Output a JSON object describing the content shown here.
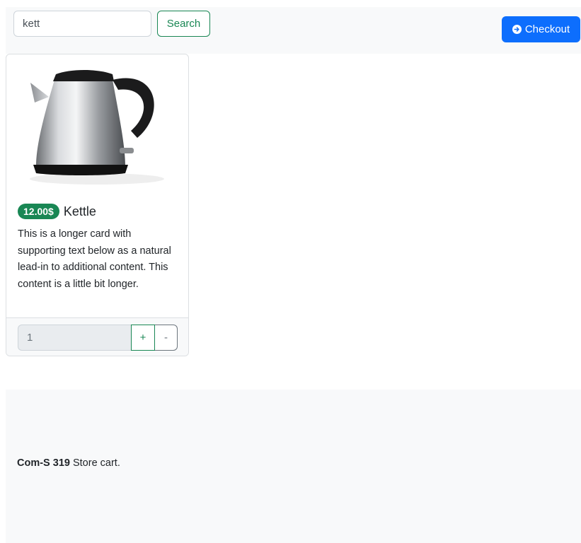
{
  "search": {
    "value": "kett",
    "button_label": "Search"
  },
  "checkout": {
    "label": "Checkout",
    "icon": "arrow-right-circle-icon",
    "color": "#0d6efd"
  },
  "product": {
    "price": "12.00$",
    "name": "Kettle",
    "description": "This is a longer card with supporting text below as a natural lead-in to additional content. This content is a little bit longer.",
    "quantity": "1",
    "plus_label": "+",
    "minus_label": "-",
    "image": "kettle-image"
  },
  "footer": {
    "course": "Com-S 319",
    "text": " Store cart."
  },
  "colors": {
    "success": "#198754",
    "primary": "#0d6efd",
    "light": "#f8f9fa"
  }
}
